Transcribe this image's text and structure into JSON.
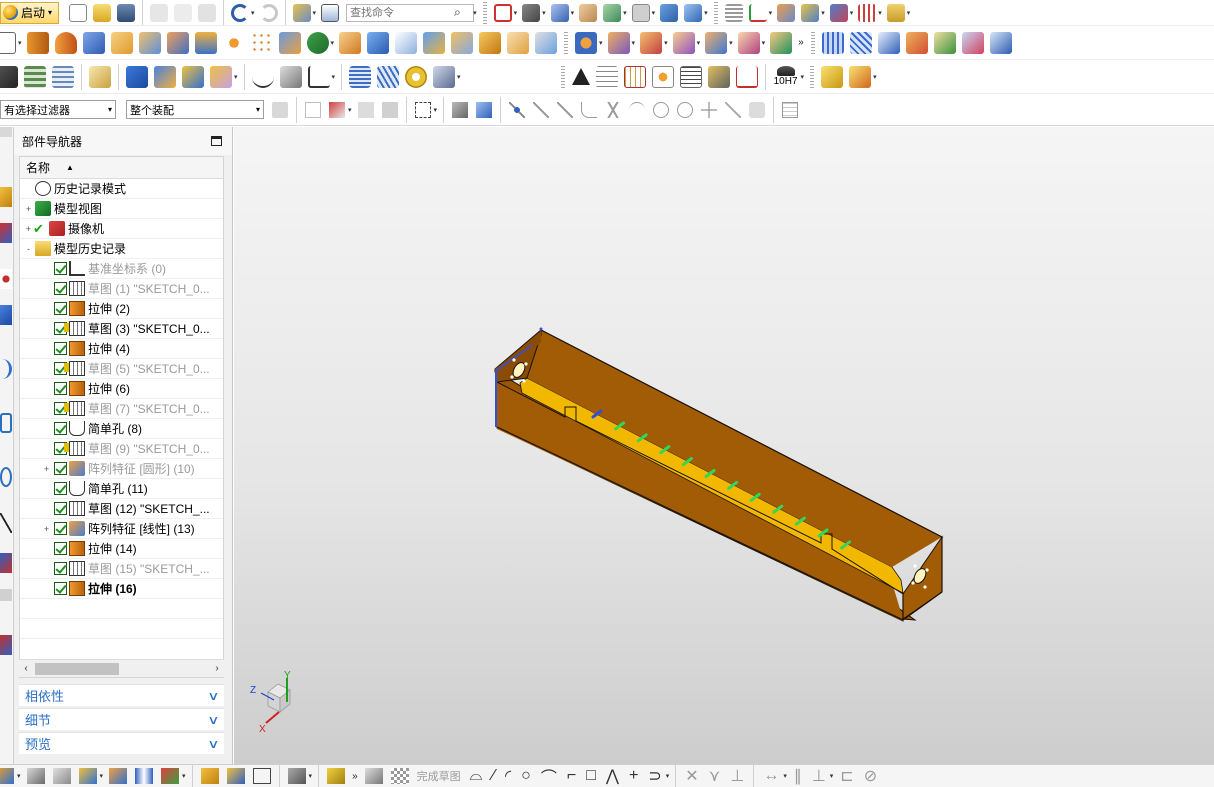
{
  "toolbar": {
    "start_label": "启动",
    "search_placeholder": "查找命令",
    "filter_value": "有选择过滤器",
    "assembly_value": "整个装配",
    "fit_tolerance_label": "10H7"
  },
  "navigator": {
    "title": "部件导航器",
    "column_name": "名称",
    "items": [
      {
        "label": "历史记录模式",
        "icon": "clock-icon",
        "state": "normal",
        "expand": ""
      },
      {
        "label": "模型视图",
        "icon": "model-views-icon",
        "state": "normal",
        "expand": "+"
      },
      {
        "label": "摄像机",
        "icon": "camera-icon",
        "state": "normal",
        "expand": "+"
      },
      {
        "label": "模型历史记录",
        "icon": "folder-open-icon",
        "state": "normal",
        "expand": "-"
      },
      {
        "label": "基准坐标系 (0)",
        "icon": "datum-csys-icon",
        "state": "dim"
      },
      {
        "label": "草图 (1) \"SKETCH_0...",
        "icon": "sketch-icon",
        "state": "dim"
      },
      {
        "label": "拉伸 (2)",
        "icon": "extrude-icon",
        "state": "normal"
      },
      {
        "label": "草图 (3) \"SKETCH_0...",
        "icon": "sketch-icon",
        "state": "normal",
        "warn": true
      },
      {
        "label": "拉伸 (4)",
        "icon": "extrude-icon",
        "state": "normal"
      },
      {
        "label": "草图 (5) \"SKETCH_0...",
        "icon": "sketch-icon",
        "state": "dim",
        "warn": true
      },
      {
        "label": "拉伸 (6)",
        "icon": "extrude-icon",
        "state": "normal"
      },
      {
        "label": "草图 (7) \"SKETCH_0...",
        "icon": "sketch-icon",
        "state": "dim",
        "warn": true
      },
      {
        "label": "简单孔 (8)",
        "icon": "hole-icon",
        "state": "normal"
      },
      {
        "label": "草图 (9) \"SKETCH_0...",
        "icon": "sketch-icon",
        "state": "dim",
        "warn": true
      },
      {
        "label": "阵列特征 [圆形] (10)",
        "icon": "pattern-icon",
        "state": "dim",
        "expand": "+"
      },
      {
        "label": "简单孔 (11)",
        "icon": "hole-icon",
        "state": "normal"
      },
      {
        "label": "草图 (12) \"SKETCH_...",
        "icon": "sketch-icon",
        "state": "normal"
      },
      {
        "label": "阵列特征 [线性] (13)",
        "icon": "pattern-icon",
        "state": "normal",
        "expand": "+"
      },
      {
        "label": "拉伸 (14)",
        "icon": "extrude-icon",
        "state": "normal"
      },
      {
        "label": "草图 (15) \"SKETCH_...",
        "icon": "sketch-icon",
        "state": "dim"
      },
      {
        "label": "拉伸 (16)",
        "icon": "extrude-icon",
        "state": "bold"
      }
    ]
  },
  "panels": {
    "dependencies": "相依性",
    "details": "细节",
    "preview": "预览"
  },
  "viewport": {
    "triad": {
      "x": "X",
      "y": "Y",
      "z": "Z"
    },
    "colors": {
      "body_top": "#a35c06",
      "body_front": "#9b5604",
      "inner_floor": "#f2b800",
      "slots": "#2fd85a",
      "edge": "#1b1206",
      "selected_edge": "#3050e0"
    }
  },
  "bottom_toolbar": {
    "finish_sketch_label": "完成草图"
  }
}
